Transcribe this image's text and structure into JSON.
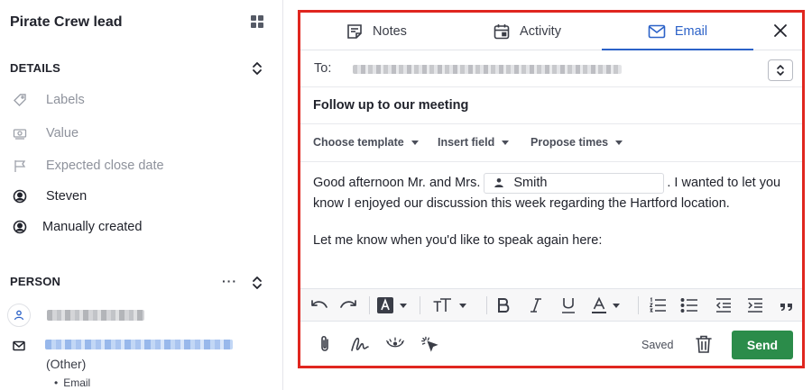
{
  "lead": {
    "title": "Pirate Crew lead",
    "details_header": "DETAILS",
    "fields": {
      "labels": "Labels",
      "value": "Value",
      "expected_close": "Expected close date",
      "owner": "Steven",
      "source": "Manually created"
    },
    "person_header": "PERSON",
    "person_more": "···",
    "email_type": "(Other)",
    "email_bullet": "Email"
  },
  "composer": {
    "tabs": [
      {
        "label": "Notes",
        "icon": "notes-icon"
      },
      {
        "label": "Activity",
        "icon": "calendar-icon"
      },
      {
        "label": "Email",
        "icon": "envelope-icon"
      }
    ],
    "active_tab": "Email",
    "to_label": "To:",
    "subject": "Follow up to our meeting",
    "options": {
      "template": "Choose template",
      "field": "Insert field",
      "times": "Propose times"
    },
    "body": {
      "line1_pre": "Good afternoon Mr. and Mrs.",
      "merge_field": "Smith",
      "line1_post": ". I wanted to let you",
      "line2": "know I enjoyed our discussion this week regarding the  Hartford location.",
      "line3": "Let me know when you'd like to speak again here:"
    },
    "footer": {
      "saved": "Saved",
      "send": "Send"
    }
  },
  "colors": {
    "accent": "#2c62c8",
    "send": "#2b8c4a",
    "highlight_border": "#e0261f"
  }
}
